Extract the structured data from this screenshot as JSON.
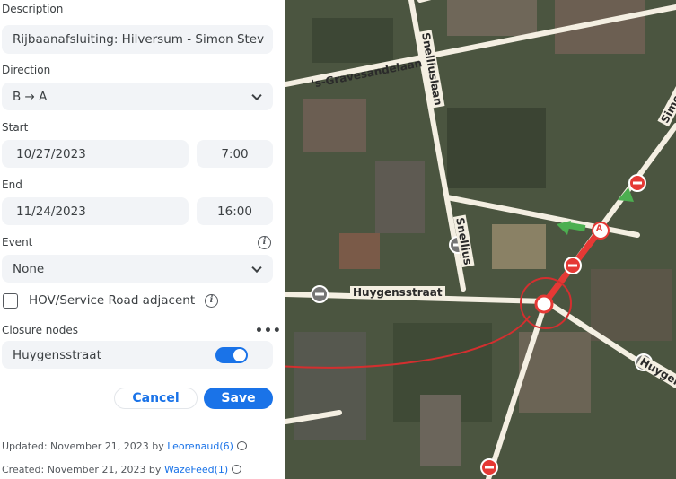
{
  "form": {
    "description": {
      "label": "Description",
      "value": "Rijbaanafsluiting: Hilversum - Simon Stev"
    },
    "direction": {
      "label": "Direction",
      "value": "B → A"
    },
    "start": {
      "label": "Start",
      "date": "10/27/2023",
      "time": "7:00"
    },
    "end": {
      "label": "End",
      "date": "11/24/2023",
      "time": "16:00"
    },
    "event": {
      "label": "Event",
      "value": "None"
    },
    "hov_label": "HOV/Service Road adjacent",
    "closure_nodes": {
      "label": "Closure nodes",
      "node_name": "Huygensstraat",
      "enabled": true
    },
    "cancel_label": "Cancel",
    "save_label": "Save"
  },
  "meta": {
    "updated_prefix": "Updated: November 21, 2023 by",
    "updated_user": "Leorenaud(6)",
    "created_prefix": "Created: November 21, 2023 by",
    "created_user": "WazeFeed(1)"
  },
  "map": {
    "streets": {
      "gravesandelaan": "'s-Gravesandelaan",
      "snelliuslaan_top": "Snelliuslaan",
      "snelliuslaan_mid": "Snellius",
      "huygensstraat": "Huygensstraat",
      "simon_right": "Simon S",
      "huygens_right": "Huygens"
    },
    "node_marker_label": "A"
  },
  "colors": {
    "accent": "#1a73e8",
    "closure": "#e53935",
    "arrow_green": "#4caf50"
  }
}
